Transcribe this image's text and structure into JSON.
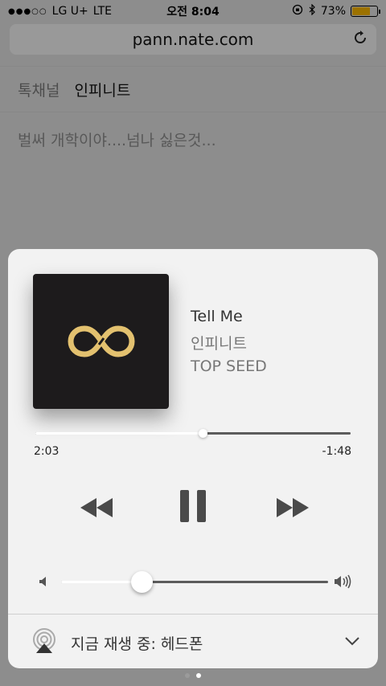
{
  "status_bar": {
    "signal": "●●●○○",
    "carrier": "LG U+",
    "network": "LTE",
    "time": "오전 8:04",
    "battery_percent": "73%",
    "battery_level": 0.73
  },
  "browser": {
    "url": "pann.nate.com"
  },
  "page": {
    "nav_section": "톡채널",
    "nav_current": "인피니트",
    "headline": "벌써 개학이야....넘나 싫은것..."
  },
  "now_playing": {
    "title": "Tell Me",
    "artist": "인피니트",
    "album": "TOP SEED",
    "artwork_icon": "infinity-logo-icon",
    "elapsed": "2:03",
    "remaining": "-1:48",
    "progress": 0.53,
    "volume": 0.3,
    "output_label": "지금 재생 중: 헤드폰"
  },
  "pager": {
    "count": 2,
    "active_index": 1
  },
  "colors": {
    "artwork_bg": "#1d1b1c",
    "logo_gold": "#e3c16f",
    "panel_bg": "#f2f2f2",
    "battery": "#f0b000"
  }
}
